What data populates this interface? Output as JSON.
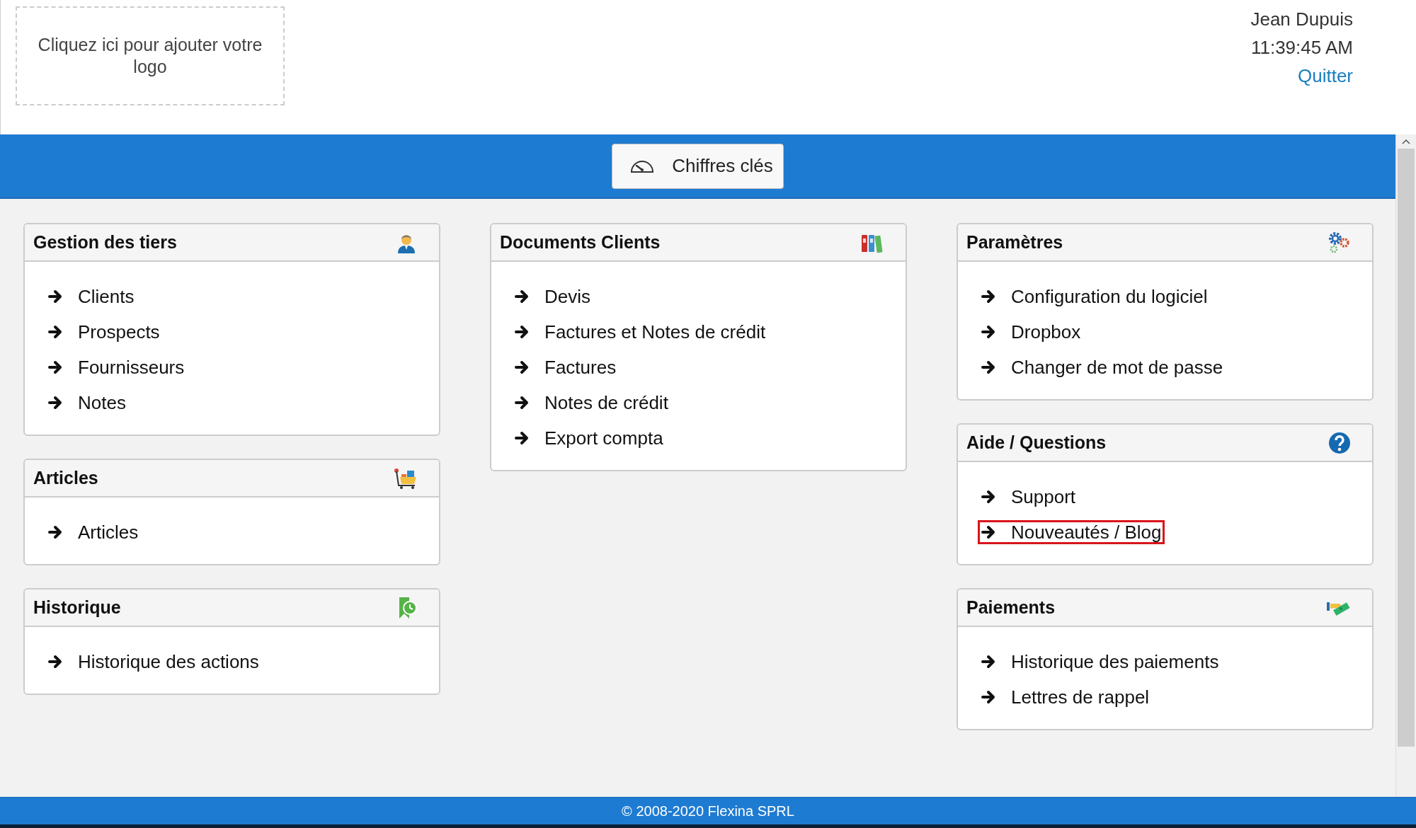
{
  "header": {
    "logo_placeholder": "Cliquez ici pour ajouter votre logo",
    "user": "Jean Dupuis",
    "time": "11:39:45 AM",
    "logout": "Quitter"
  },
  "toolbar": {
    "button": "Chiffres clés"
  },
  "columns": [
    [
      {
        "title": "Gestion des tiers",
        "items": [
          {
            "label": "Clients",
            "highlighted": false
          },
          {
            "label": "Prospects",
            "highlighted": false
          },
          {
            "label": "Fournisseurs",
            "highlighted": false
          },
          {
            "label": "Notes",
            "highlighted": false
          }
        ]
      },
      {
        "title": "Articles",
        "items": [
          {
            "label": "Articles",
            "highlighted": false
          }
        ]
      },
      {
        "title": "Historique",
        "items": [
          {
            "label": "Historique des actions",
            "highlighted": false
          }
        ]
      }
    ],
    [
      {
        "title": "Documents Clients",
        "items": [
          {
            "label": "Devis",
            "highlighted": false
          },
          {
            "label": "Factures et Notes de crédit",
            "highlighted": false
          },
          {
            "label": "Factures",
            "highlighted": false
          },
          {
            "label": "Notes de crédit",
            "highlighted": false
          },
          {
            "label": "Export compta",
            "highlighted": false
          }
        ]
      }
    ],
    [
      {
        "title": "Paramètres",
        "items": [
          {
            "label": "Configuration du logiciel",
            "highlighted": false
          },
          {
            "label": "Dropbox",
            "highlighted": false
          },
          {
            "label": "Changer de mot de passe",
            "highlighted": false
          }
        ]
      },
      {
        "title": "Aide / Questions",
        "items": [
          {
            "label": "Support",
            "highlighted": false
          },
          {
            "label": "Nouveautés / Blog",
            "highlighted": true
          }
        ]
      },
      {
        "title": "Paiements",
        "items": [
          {
            "label": "Historique des paiements",
            "highlighted": false
          },
          {
            "label": "Lettres de rappel",
            "highlighted": false
          }
        ]
      }
    ]
  ],
  "footer": "© 2008-2020 Flexina SPRL"
}
